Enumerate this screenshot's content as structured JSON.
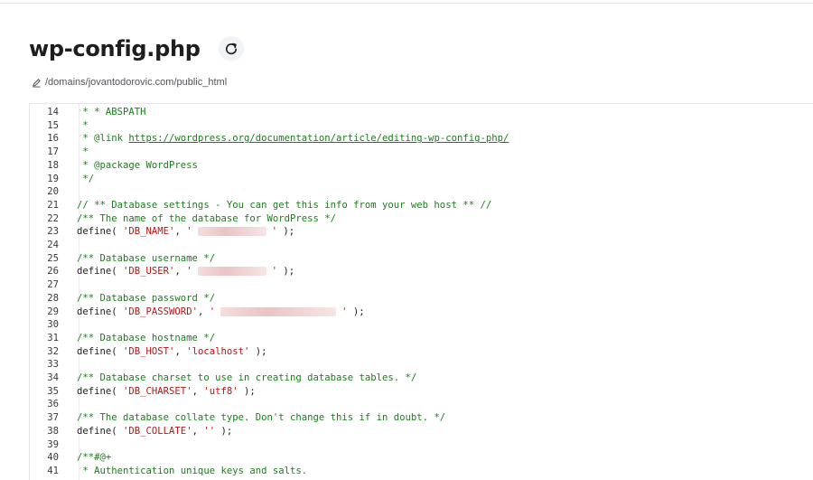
{
  "header": {
    "title": "wp-config.php",
    "path": "/domains/jovantodorovic.com/public_html"
  },
  "colors": {
    "comment": "#1e7c1e",
    "string": "#b01818",
    "text": "#1f1f24"
  },
  "editor": {
    "lines": [
      {
        "n": "14",
        "comment": " * * ABSPATH"
      },
      {
        "n": "15",
        "comment": " *"
      },
      {
        "n": "16",
        "comment": " * @link ",
        "link": "https://wordpress.org/documentation/article/editing-wp-config-php/"
      },
      {
        "n": "17",
        "comment": " *"
      },
      {
        "n": "18",
        "comment": " * @package WordPress"
      },
      {
        "n": "19",
        "comment": " */"
      },
      {
        "n": "20"
      },
      {
        "n": "21",
        "comment": "// ** Database settings - You can get this info from your web host ** //"
      },
      {
        "n": "22",
        "comment": "/** The name of the database for WordPress */"
      },
      {
        "n": "23",
        "fn": "define( ",
        "key": "'DB_NAME'",
        "sep": ", ",
        "val_open": "'",
        "redacted": true,
        "val_close": "'",
        "end": " );"
      },
      {
        "n": "24"
      },
      {
        "n": "25",
        "comment": "/** Database username */"
      },
      {
        "n": "26",
        "fn": "define( ",
        "key": "'DB_USER'",
        "sep": ", ",
        "val_open": "'",
        "redacted": true,
        "val_close": "'",
        "end": " );"
      },
      {
        "n": "27"
      },
      {
        "n": "28",
        "comment": "/** Database password */"
      },
      {
        "n": "29",
        "fn": "define( ",
        "key": "'DB_PASSWORD'",
        "sep": ", ",
        "val_open": "'",
        "redacted": true,
        "val_close": "'",
        "end": " );"
      },
      {
        "n": "30"
      },
      {
        "n": "31",
        "comment": "/** Database hostname */"
      },
      {
        "n": "32",
        "fn": "define( ",
        "key": "'DB_HOST'",
        "sep": ", ",
        "value": "'localhost'",
        "end": " );"
      },
      {
        "n": "33"
      },
      {
        "n": "34",
        "comment": "/** Database charset to use in creating database tables. */"
      },
      {
        "n": "35",
        "fn": "define( ",
        "key": "'DB_CHARSET'",
        "sep": ", ",
        "value": "'utf8'",
        "end": " );"
      },
      {
        "n": "36"
      },
      {
        "n": "37",
        "comment": "/** The database collate type. Don't change this if in doubt. */"
      },
      {
        "n": "38",
        "fn": "define( ",
        "key": "'DB_COLLATE'",
        "sep": ", ",
        "value": "''",
        "end": " );"
      },
      {
        "n": "39"
      },
      {
        "n": "40",
        "comment": "/**#@+"
      },
      {
        "n": "41",
        "comment": " * Authentication unique keys and salts."
      }
    ]
  }
}
